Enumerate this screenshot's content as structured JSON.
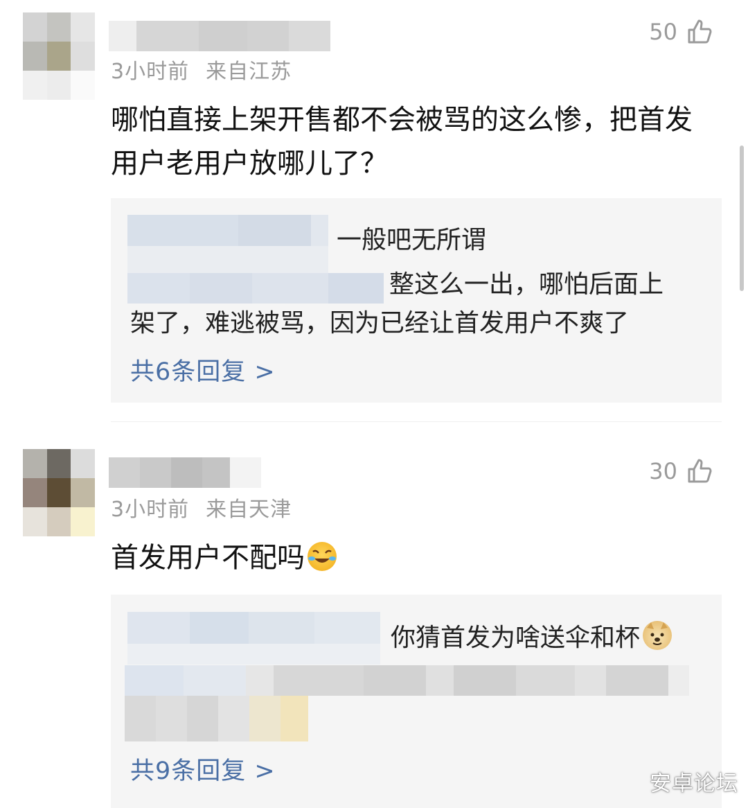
{
  "comments": [
    {
      "time": "3小时前",
      "location": "来自江苏",
      "likes": "50",
      "text": "哪怕直接上架开售都不会被骂的这么惨，把首发用户老用户放哪儿了？",
      "replies": [
        {
          "text": "一般吧无所谓"
        },
        {
          "text_line1": "整这么一出，哪怕后面上",
          "text_line2": "架了，难逃被骂，因为已经让首发用户不爽了"
        }
      ],
      "more_replies": "共6条回复 >"
    },
    {
      "time": "3小时前",
      "location": "来自天津",
      "likes": "30",
      "text": "首发用户不配吗",
      "emoji": "laughing-crying-emoji",
      "replies": [
        {
          "text": "你猜首发为啥送伞和杯",
          "emoji": "doge-emoji"
        }
      ],
      "more_replies": "共9条回复 >"
    }
  ],
  "watermark": "安卓论坛",
  "colors": {
    "link": "#4a6fa5",
    "meta": "#9a9a9a",
    "reply_bg": "#f5f5f5"
  }
}
